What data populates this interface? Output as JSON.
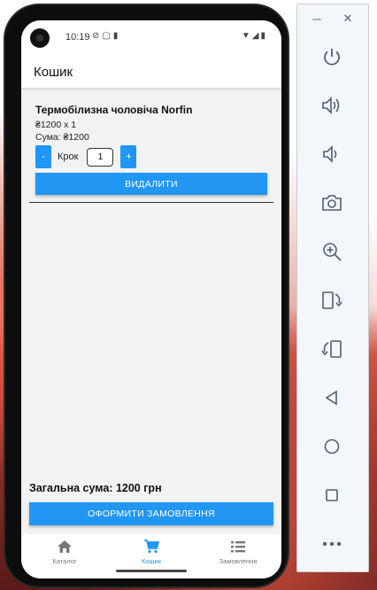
{
  "status_bar": {
    "time": "10:19"
  },
  "app_bar": {
    "title": "Кошик"
  },
  "cart": {
    "items": [
      {
        "name": "Термобілизна чоловіча Norfin",
        "price_line": "₴1200 x 1",
        "sum_line": "Сума: ₴1200",
        "step_label": "Крок",
        "step_value": "1",
        "minus_label": "-",
        "plus_label": "+",
        "delete_label": "ВИДАЛИТИ"
      }
    ],
    "total_text": "Загальна сума: 1200 грн",
    "checkout_label": "ОФОРМИТИ ЗАМОВЛЕННЯ"
  },
  "bottom_nav": {
    "items": [
      {
        "label": "Каталог",
        "icon": "home-icon",
        "active": false
      },
      {
        "label": "Кошик",
        "icon": "cart-icon",
        "active": true
      },
      {
        "label": "Замовлення",
        "icon": "list-icon",
        "active": false
      }
    ]
  },
  "emulator_panel": {
    "controls": [
      "minimize-icon",
      "close-icon"
    ],
    "buttons": [
      "power-icon",
      "volume-up-icon",
      "volume-down-icon",
      "camera-icon",
      "zoom-icon",
      "rotate-left-icon",
      "rotate-right-icon",
      "back-icon",
      "home-circle-icon",
      "overview-icon",
      "more-icon"
    ]
  },
  "colors": {
    "accent": "#2196f3",
    "background": "#f2f2f2",
    "text": "#111111"
  }
}
